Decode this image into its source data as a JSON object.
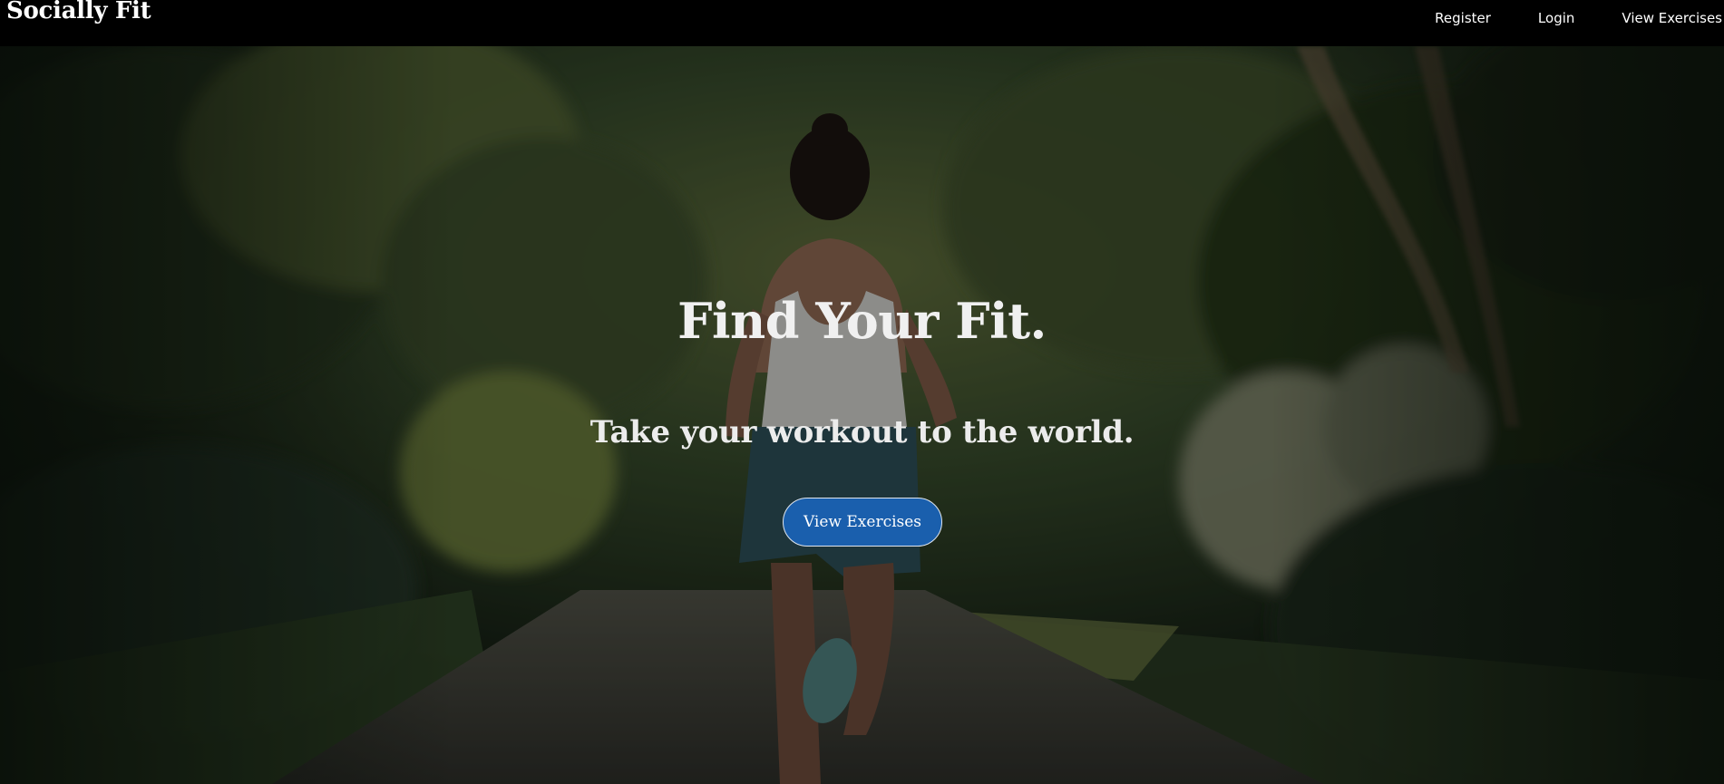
{
  "navbar": {
    "brand": "Socially Fit",
    "links": [
      {
        "label": "Register"
      },
      {
        "label": "Login"
      },
      {
        "label": "View Exercises"
      }
    ]
  },
  "hero": {
    "title": "Find Your Fit.",
    "subtitle": "Take your workout to the world.",
    "cta_label": "View Exercises",
    "image_description": "woman-running-on-forest-path"
  },
  "colors": {
    "navbar_bg": "#000000",
    "text_primary": "#ffffff",
    "cta_bg": "#1a5fad",
    "cta_border": "#dfe6ef"
  }
}
